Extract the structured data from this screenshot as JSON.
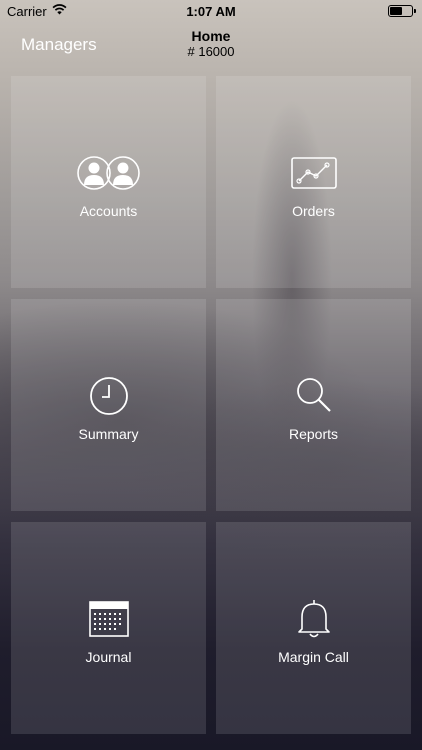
{
  "status": {
    "carrier": "Carrier",
    "time": "1:07 AM"
  },
  "nav": {
    "back_label": "Managers",
    "title": "Home",
    "subtitle": "# 16000"
  },
  "tiles": [
    {
      "label": "Accounts",
      "icon": "accounts-icon"
    },
    {
      "label": "Orders",
      "icon": "orders-chart-icon"
    },
    {
      "label": "Summary",
      "icon": "clock-icon"
    },
    {
      "label": "Reports",
      "icon": "search-icon"
    },
    {
      "label": "Journal",
      "icon": "calendar-icon"
    },
    {
      "label": "Margin Call",
      "icon": "bell-icon"
    }
  ],
  "colors": {
    "tile_fill": "rgba(255,255,255,0.12)",
    "text": "#ffffff"
  }
}
